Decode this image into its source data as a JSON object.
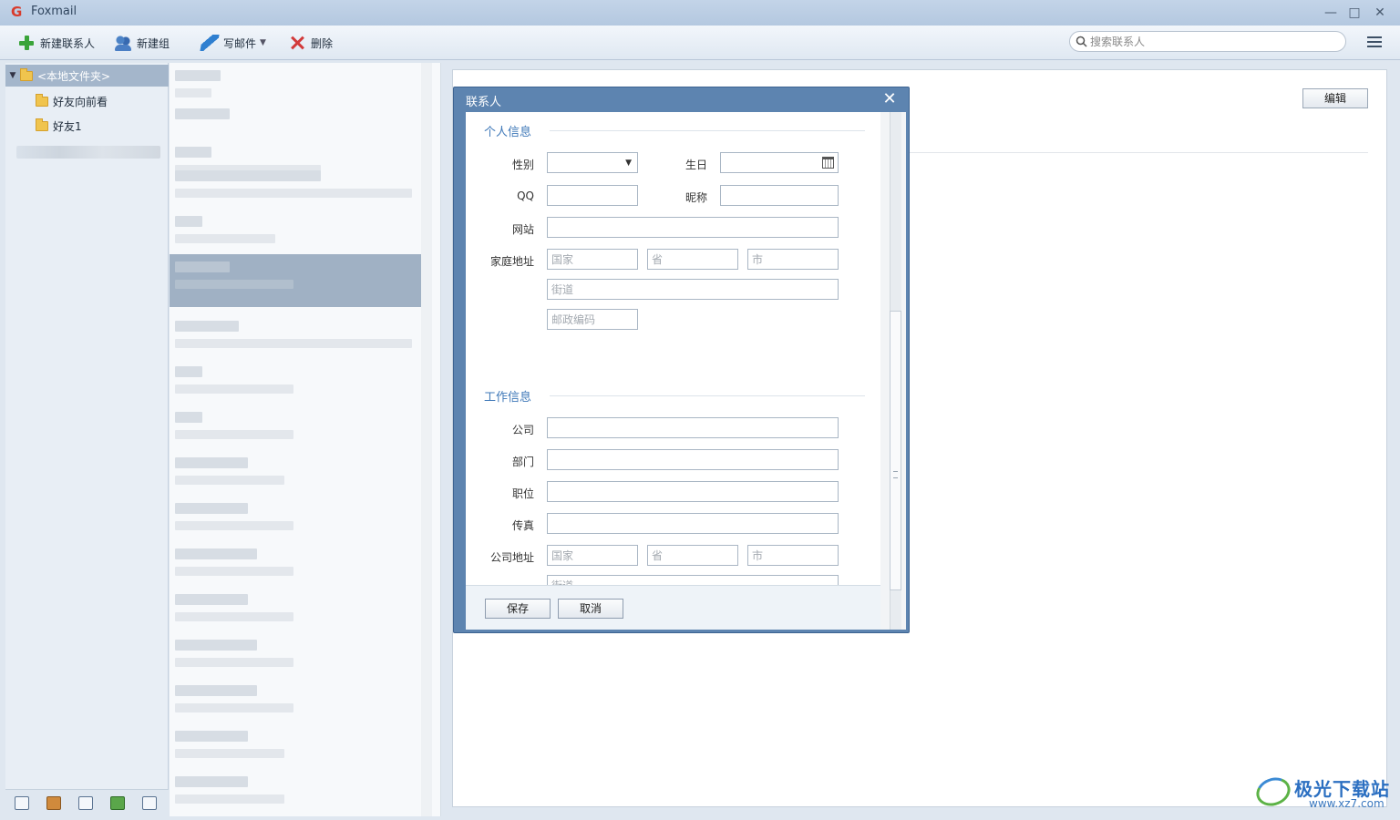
{
  "app": {
    "title": "Foxmail"
  },
  "window_controls": {
    "minimize": "—",
    "maximize": "□",
    "close": "✕"
  },
  "toolbar": {
    "new_contact": "新建联系人",
    "new_group": "新建组",
    "write_mail": "写邮件",
    "delete": "删除",
    "search_placeholder": "搜索联系人"
  },
  "sidebar": {
    "root": "<本地文件夹>",
    "items": [
      {
        "label": "好友向前看"
      },
      {
        "label": "好友1"
      }
    ]
  },
  "detail": {
    "edit_label": "编辑"
  },
  "dialog": {
    "title": "联系人",
    "personal": {
      "section_title": "个人信息",
      "gender_label": "性别",
      "gender_value": "",
      "birthday_label": "生日",
      "qq_label": "QQ",
      "nickname_label": "昵称",
      "website_label": "网站",
      "home_address_label": "家庭地址",
      "country_placeholder": "国家",
      "province_placeholder": "省",
      "city_placeholder": "市",
      "street_placeholder": "街道",
      "zip_placeholder": "邮政编码"
    },
    "work": {
      "section_title": "工作信息",
      "company_label": "公司",
      "department_label": "部门",
      "position_label": "职位",
      "fax_label": "传真",
      "company_address_label": "公司地址",
      "country_placeholder": "国家",
      "province_placeholder": "省",
      "city_placeholder": "市",
      "street_placeholder": "街道"
    },
    "save_label": "保存",
    "cancel_label": "取消"
  },
  "watermark": {
    "text": "极光下载站",
    "url": "www.xz7.com"
  },
  "colors": {
    "accent": "#3f78b8",
    "titlebar": "#b4c8e0",
    "dialog_frame": "#5d84b0",
    "selected_row": "#a0b1c4"
  }
}
